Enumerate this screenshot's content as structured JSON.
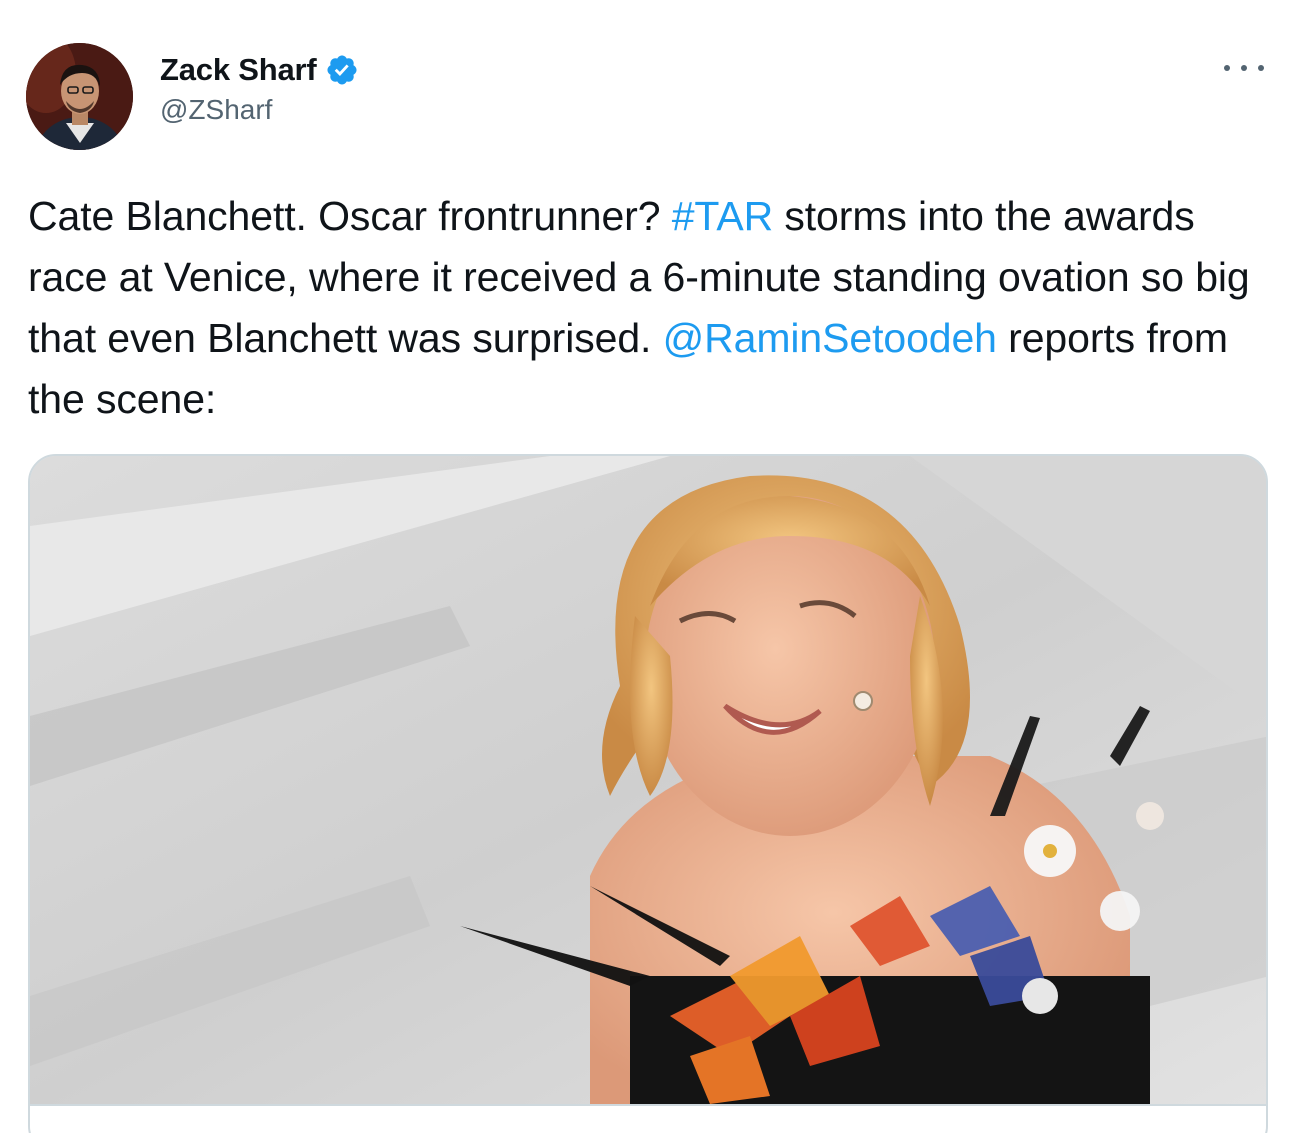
{
  "author": {
    "display_name": "Zack Sharf",
    "handle": "@ZSharf",
    "verified": true
  },
  "menu": {
    "icon": "more-horizontal-icon"
  },
  "tweet": {
    "text_1": "Cate Blanchett. Oscar frontrunner? ",
    "hashtag": "#TAR",
    "text_2": " storms into the awards race at Venice, where it received a 6-minute standing ovation so big that even Blanchett was surprised. ",
    "mention": "@RaminSetoodeh",
    "text_3": " reports from the scene:"
  },
  "colors": {
    "link": "#1d9bf0",
    "verified_badge": "#1d9bf0",
    "secondary_text": "#536471",
    "card_border": "#cfd9de"
  }
}
